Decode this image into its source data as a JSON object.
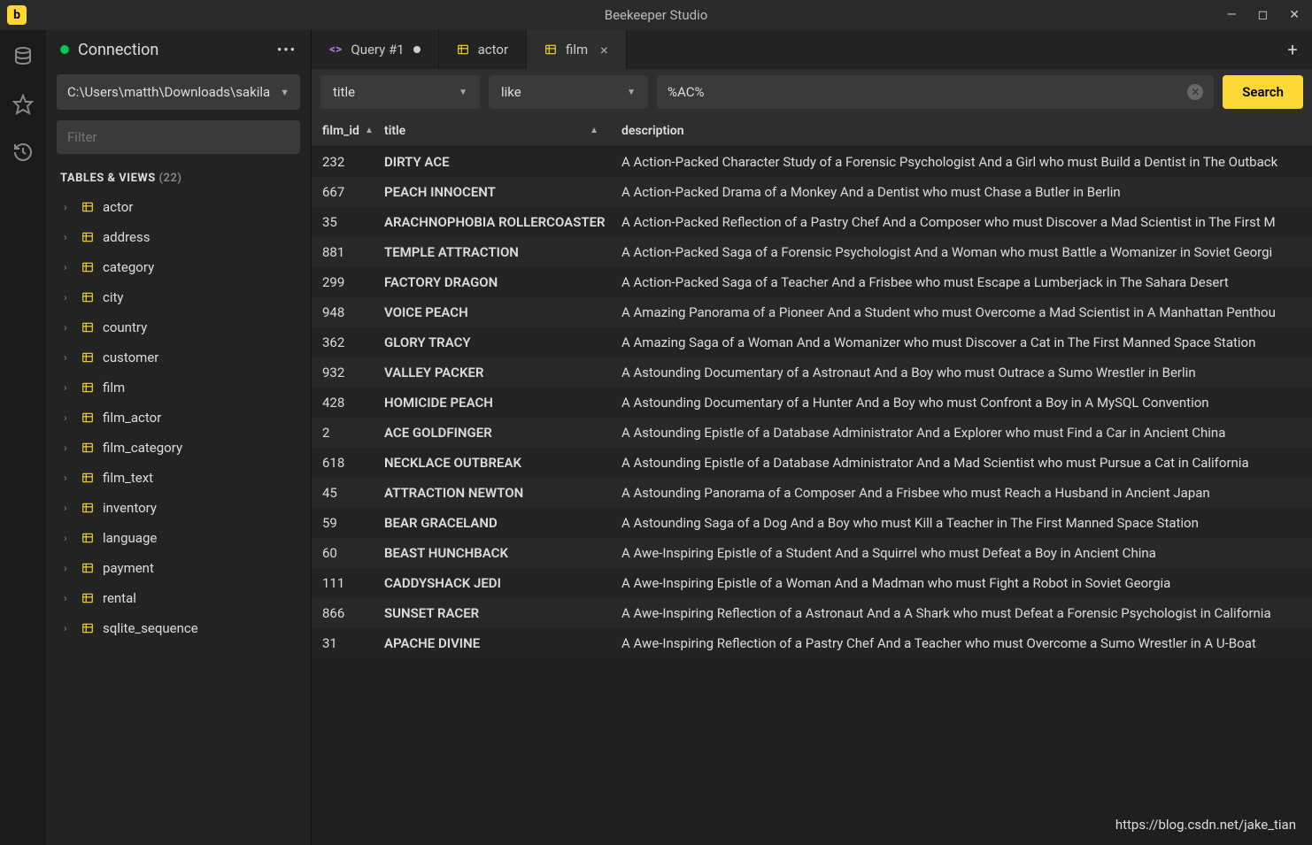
{
  "app_title": "Beekeeper Studio",
  "connection": {
    "label": "Connection",
    "db_path": "C:\\Users\\matth\\Downloads\\sakila",
    "filter_placeholder": "Filter"
  },
  "section": {
    "label": "TABLES & VIEWS",
    "count": "(22)"
  },
  "tables": [
    "actor",
    "address",
    "category",
    "city",
    "country",
    "customer",
    "film",
    "film_actor",
    "film_category",
    "film_text",
    "inventory",
    "language",
    "payment",
    "rental",
    "sqlite_sequence"
  ],
  "tabs": [
    {
      "kind": "query",
      "label": "Query #1",
      "dirty": true
    },
    {
      "kind": "table",
      "label": "actor",
      "dirty": false
    },
    {
      "kind": "table",
      "label": "film",
      "dirty": false,
      "active": true,
      "closable": true
    }
  ],
  "filter": {
    "column": "title",
    "operator": "like",
    "value": "%AC%",
    "search_label": "Search"
  },
  "columns": {
    "c1": "film_id",
    "c2": "title",
    "c3": "description"
  },
  "rows": [
    {
      "id": "232",
      "title": "DIRTY ACE",
      "desc": "A Action-Packed Character Study of a Forensic Psychologist And a Girl who must Build a Dentist in The Outback"
    },
    {
      "id": "667",
      "title": "PEACH INNOCENT",
      "desc": "A Action-Packed Drama of a Monkey And a Dentist who must Chase a Butler in Berlin"
    },
    {
      "id": "35",
      "title": "ARACHNOPHOBIA ROLLERCOASTER",
      "desc": "A Action-Packed Reflection of a Pastry Chef And a Composer who must Discover a Mad Scientist in The First M"
    },
    {
      "id": "881",
      "title": "TEMPLE ATTRACTION",
      "desc": "A Action-Packed Saga of a Forensic Psychologist And a Woman who must Battle a Womanizer in Soviet Georgi"
    },
    {
      "id": "299",
      "title": "FACTORY DRAGON",
      "desc": "A Action-Packed Saga of a Teacher And a Frisbee who must Escape a Lumberjack in The Sahara Desert"
    },
    {
      "id": "948",
      "title": "VOICE PEACH",
      "desc": "A Amazing Panorama of a Pioneer And a Student who must Overcome a Mad Scientist in A Manhattan Penthou"
    },
    {
      "id": "362",
      "title": "GLORY TRACY",
      "desc": "A Amazing Saga of a Woman And a Womanizer who must Discover a Cat in The First Manned Space Station"
    },
    {
      "id": "932",
      "title": "VALLEY PACKER",
      "desc": "A Astounding Documentary of a Astronaut And a Boy who must Outrace a Sumo Wrestler in Berlin"
    },
    {
      "id": "428",
      "title": "HOMICIDE PEACH",
      "desc": "A Astounding Documentary of a Hunter And a Boy who must Confront a Boy in A MySQL Convention"
    },
    {
      "id": "2",
      "title": "ACE GOLDFINGER",
      "desc": "A Astounding Epistle of a Database Administrator And a Explorer who must Find a Car in Ancient China"
    },
    {
      "id": "618",
      "title": "NECKLACE OUTBREAK",
      "desc": "A Astounding Epistle of a Database Administrator And a Mad Scientist who must Pursue a Cat in California"
    },
    {
      "id": "45",
      "title": "ATTRACTION NEWTON",
      "desc": "A Astounding Panorama of a Composer And a Frisbee who must Reach a Husband in Ancient Japan"
    },
    {
      "id": "59",
      "title": "BEAR GRACELAND",
      "desc": "A Astounding Saga of a Dog And a Boy who must Kill a Teacher in The First Manned Space Station"
    },
    {
      "id": "60",
      "title": "BEAST HUNCHBACK",
      "desc": "A Awe-Inspiring Epistle of a Student And a Squirrel who must Defeat a Boy in Ancient China"
    },
    {
      "id": "111",
      "title": "CADDYSHACK JEDI",
      "desc": "A Awe-Inspiring Epistle of a Woman And a Madman who must Fight a Robot in Soviet Georgia"
    },
    {
      "id": "866",
      "title": "SUNSET RACER",
      "desc": "A Awe-Inspiring Reflection of a Astronaut And a A Shark who must Defeat a Forensic Psychologist in California"
    },
    {
      "id": "31",
      "title": "APACHE DIVINE",
      "desc": "A Awe-Inspiring Reflection of a Pastry Chef And a Teacher who must Overcome a Sumo Wrestler in A U-Boat"
    }
  ],
  "watermark": "https://blog.csdn.net/jake_tian"
}
